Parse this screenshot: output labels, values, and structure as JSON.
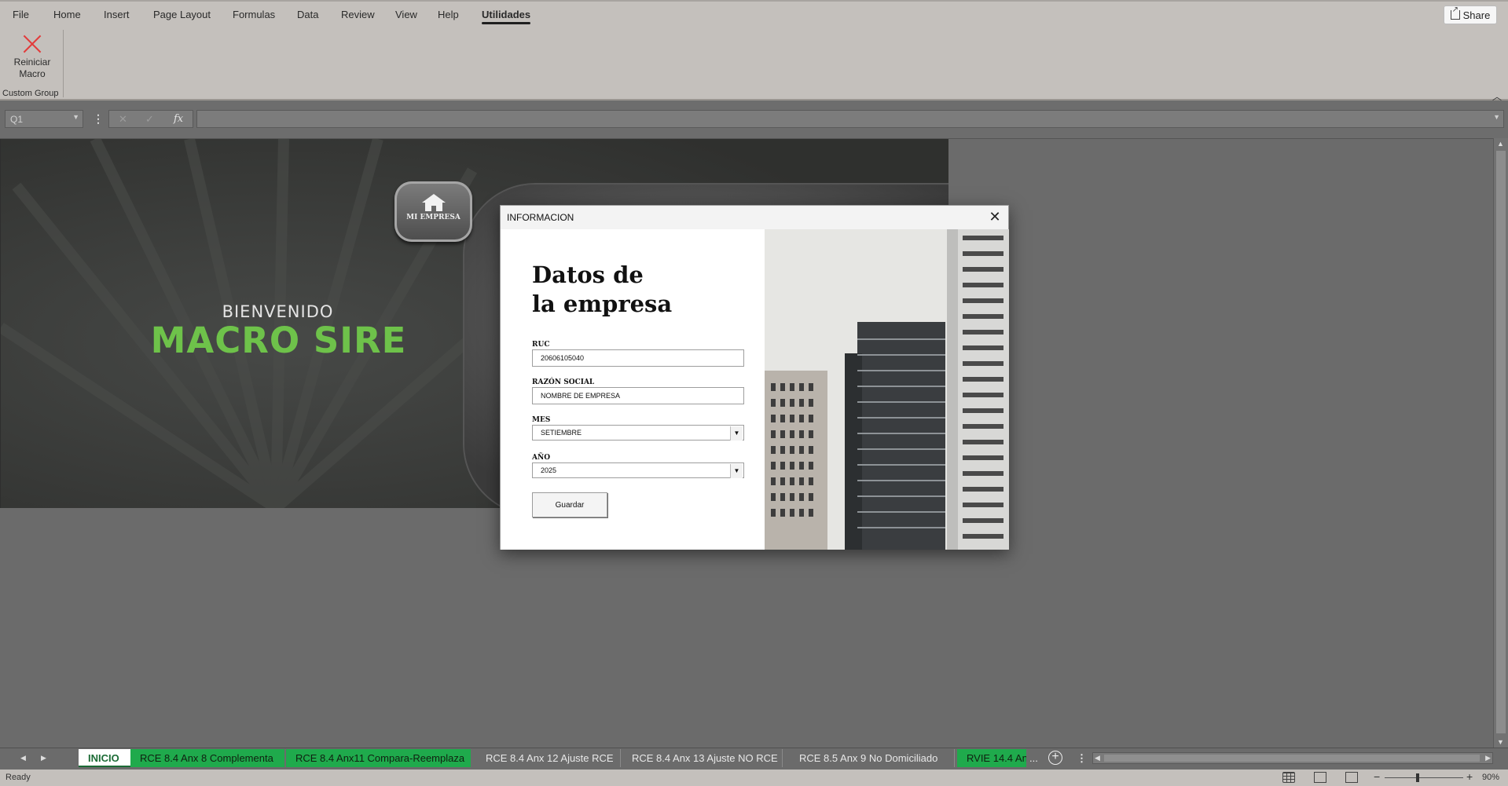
{
  "ribbon": {
    "tabs": [
      "File",
      "Home",
      "Insert",
      "Page Layout",
      "Formulas",
      "Data",
      "Review",
      "View",
      "Help",
      "Utilidades"
    ],
    "active_tab": "Utilidades",
    "share_label": "Share",
    "reiniciar_label_1": "Reiniciar",
    "reiniciar_label_2": "Macro",
    "group_label": "Custom Group"
  },
  "formula_bar": {
    "namebox": "Q1",
    "fx": "fx",
    "formula": ""
  },
  "banner": {
    "welcome": "BIENVENIDO",
    "title": "MACRO SIRE",
    "home_label": "MI EMPRESA",
    "title_color": "#6ec24a"
  },
  "dialog": {
    "title": "INFORMACION",
    "heading_line1": "Datos de",
    "heading_line2": "la empresa",
    "ruc_label": "RUC",
    "ruc_value": "20606105040",
    "razon_label": "RAZÓN SOCIAL",
    "razon_value": "NOMBRE DE EMPRESA",
    "mes_label": "MES",
    "mes_value": "SETIEMBRE",
    "anio_label": "AÑO",
    "anio_value": "2025",
    "save_label": "Guardar"
  },
  "sheet_tabs": [
    {
      "label": "INICIO",
      "style": "active"
    },
    {
      "label": "RCE 8.4 Anx 8 Complementa",
      "style": "green"
    },
    {
      "label": "RCE 8.4 Anx11 Compara-Reemplaza",
      "style": "green"
    },
    {
      "label": "RCE 8.4 Anx 12 Ajuste RCE",
      "style": "plain"
    },
    {
      "label": "RCE 8.4 Anx 13 Ajuste NO RCE",
      "style": "plain"
    },
    {
      "label": "RCE 8.5 Anx 9 No Domiciliado",
      "style": "plain"
    },
    {
      "label": "RVIE 14.4 An",
      "style": "green"
    }
  ],
  "tab_more": "...",
  "status": {
    "ready": "Ready",
    "zoom": "90%"
  }
}
